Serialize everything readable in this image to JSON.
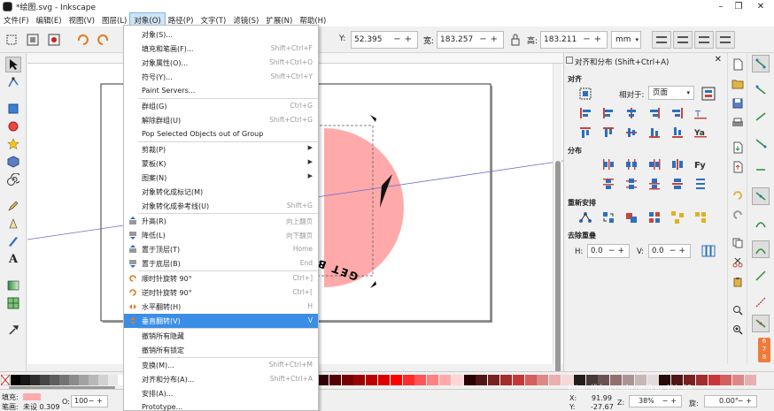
{
  "window": {
    "title": "*绘图.svg - Inkscape",
    "buttons": [
      "–",
      "❐",
      "✕"
    ]
  },
  "menubar": [
    {
      "label": "文件(F)"
    },
    {
      "label": "编辑(E)"
    },
    {
      "label": "视图(V)"
    },
    {
      "label": "图层(L)"
    },
    {
      "label": "对象(O)"
    },
    {
      "label": "路径(P)"
    },
    {
      "label": "文字(T)"
    },
    {
      "label": "滤镜(S)"
    },
    {
      "label": "扩展(N)"
    },
    {
      "label": "帮助(H)"
    }
  ],
  "toolbar": {
    "y_label": "Y:",
    "y_value": "52.395",
    "w_label": "宽:",
    "w_value": "183.257",
    "h_label": "高:",
    "h_value": "183.211",
    "unit": "mm"
  },
  "object_menu": {
    "items": [
      {
        "label": "对象(S)...",
        "shortcut": ""
      },
      {
        "label": "填充和笔画(F)...",
        "shortcut": "Shift+Ctrl+F"
      },
      {
        "label": "对象属性(O)...",
        "shortcut": "Shift+Ctrl+O"
      },
      {
        "label": "符号(Y)...",
        "shortcut": "Shift+Ctrl+Y"
      },
      {
        "label": "Paint Servers...",
        "shortcut": ""
      },
      {
        "label": "群组(G)",
        "shortcut": "Ctrl+G"
      },
      {
        "label": "解除群组(U)",
        "shortcut": "Shift+Ctrl+G"
      },
      {
        "label": "Pop Selected Objects out of Group",
        "shortcut": ""
      },
      {
        "label": "剪裁(P)",
        "shortcut": ""
      },
      {
        "label": "蒙板(K)",
        "shortcut": ""
      },
      {
        "label": "图案(N)",
        "shortcut": ""
      },
      {
        "label": "对象转化成标记(M)",
        "shortcut": ""
      },
      {
        "label": "对象转化成参考线(U)",
        "shortcut": "Shift+G"
      },
      {
        "label": "升高(R)",
        "shortcut": "向上翻页"
      },
      {
        "label": "降低(L)",
        "shortcut": "向下翻页"
      },
      {
        "label": "置于顶层(T)",
        "shortcut": "Home"
      },
      {
        "label": "置于底层(B)",
        "shortcut": "End"
      },
      {
        "label": "顺时针旋转 90°",
        "shortcut": "Ctrl+]"
      },
      {
        "label": "逆时针旋转 90°",
        "shortcut": "Ctrl+["
      },
      {
        "label": "水平翻转(H)",
        "shortcut": "H"
      },
      {
        "label": "垂直翻转(V)",
        "shortcut": "V"
      },
      {
        "label": "撤销所有隐藏",
        "shortcut": ""
      },
      {
        "label": "撤销所有锁定",
        "shortcut": ""
      },
      {
        "label": "变换(M)...",
        "shortcut": "Shift+Ctrl+M"
      },
      {
        "label": "对齐和分布(A)...",
        "shortcut": "Shift+Ctrl+A"
      },
      {
        "label": "安排(A)...",
        "shortcut": ""
      },
      {
        "label": "Prototype...",
        "shortcut": ""
      }
    ],
    "highlighted_label": "垂直翻转(V)"
  },
  "dock": {
    "title": "对齐和分布 (Shift+Ctrl+A)",
    "align_header": "对齐",
    "relative_label": "相对于:",
    "relative_value": "页面",
    "distribute_header": "分布",
    "rearrange_header": "重新安排",
    "remove_overlap_header": "去除重叠",
    "h_label": "H:",
    "h_value": "0.0",
    "v_label": "V:",
    "v_value": "0.0"
  },
  "canvas": {
    "circle_color": "#ffaaaa",
    "arc_text": "GET B",
    "guide_color": "#6b6bd6"
  },
  "status": {
    "fill_label": "填充:",
    "fill_color": "#ffaaaa",
    "stroke_label": "笔画:",
    "stroke_value": "未设 0.309",
    "o_label": "O:",
    "o_value": "100",
    "x_label": "X:",
    "x_value": "91.99",
    "y_label": "Y:",
    "y_value": "-27.67",
    "z_label": "Z:",
    "zoom": "38%",
    "r_label": "旋:",
    "rotation": "0.00°"
  },
  "watermark": "https://blog.csdn.net/Liu_LY_99"
}
